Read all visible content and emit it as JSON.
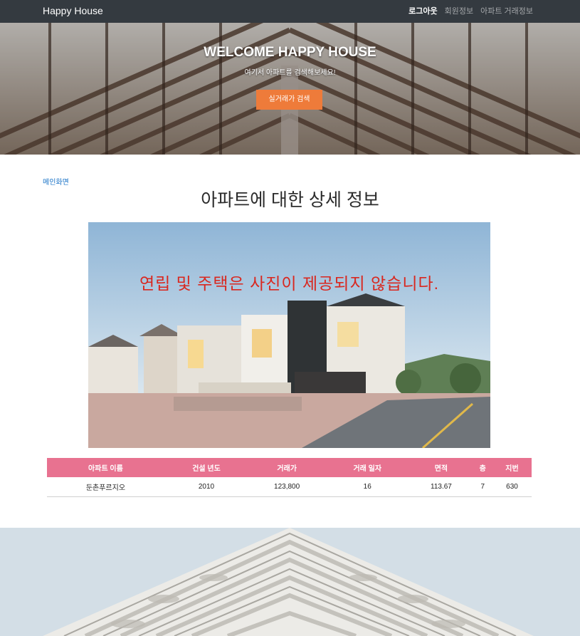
{
  "navbar": {
    "brand": "Happy House",
    "links": [
      {
        "label": "로그아웃",
        "active": true
      },
      {
        "label": "회원정보",
        "active": false
      },
      {
        "label": "아파트 거래정보",
        "active": false
      }
    ]
  },
  "hero": {
    "title": "WELCOME HAPPY HOUSE",
    "subtitle": "여기서 아파트를 검색해보세요!",
    "button_label": "실거래가 검색",
    "button_color": "#ee7b3a"
  },
  "breadcrumb": "메인화면",
  "page_title": "아파트에 대한 상세 정보",
  "photo_note": "연립 및 주택은 사진이 제공되지 않습니다.",
  "table": {
    "header_color": "#e87290",
    "headers": [
      "아파트 이름",
      "건설 년도",
      "거래가",
      "거래 일자",
      "면적",
      "층",
      "지번"
    ],
    "rows": [
      [
        "둔촌푸르지오",
        "2010",
        "123,800",
        "16",
        "113.67",
        "7",
        "630"
      ]
    ]
  }
}
